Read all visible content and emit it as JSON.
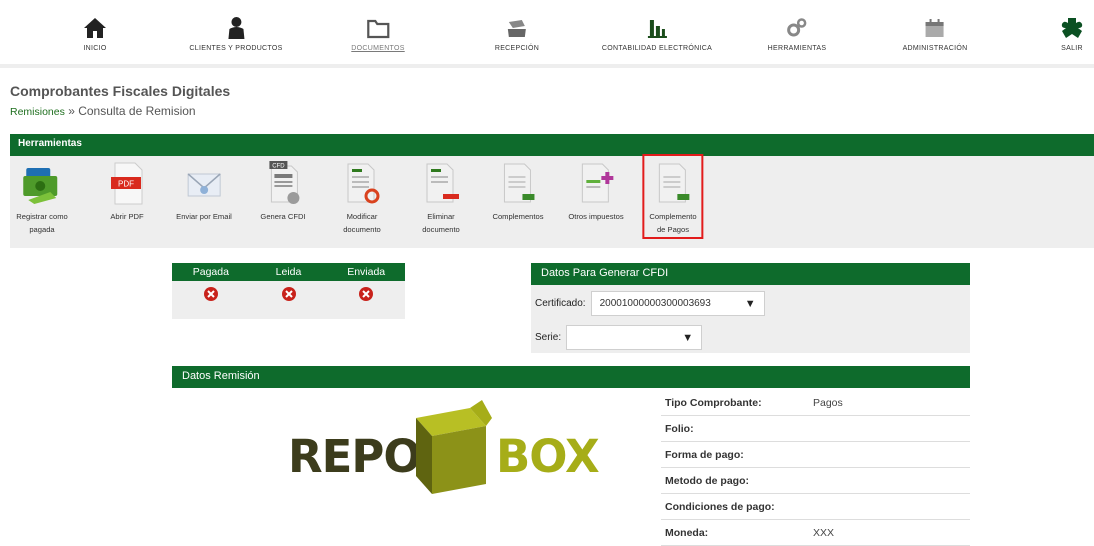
{
  "nav": {
    "items": [
      {
        "label": "INICIO",
        "icon": "home-icon"
      },
      {
        "label": "CLIENTES Y PRODUCTOS",
        "icon": "person-icon"
      },
      {
        "label": "DOCUMENTOS",
        "icon": "folder-icon",
        "active": true
      },
      {
        "label": "RECEPCIÓN",
        "icon": "inbox-icon"
      },
      {
        "label": "CONTABILIDAD ELECTRÓNICA",
        "icon": "bar-chart-icon"
      },
      {
        "label": "HERRAMIENTAS",
        "icon": "gears-icon"
      },
      {
        "label": "ADMINISTRACIÓN",
        "icon": "calendar-icon"
      },
      {
        "label": "SALIR",
        "icon": "puzzle-icon"
      }
    ]
  },
  "page": {
    "title": "Comprobantes Fiscales Digitales",
    "breadcrumb_link": "Remisiones",
    "breadcrumb_sep": " » ",
    "breadcrumb_current": "Consulta de Remision"
  },
  "tools": {
    "header": "Herramientas",
    "items": [
      {
        "label": "Registrar como\npagada",
        "icon": "money-icon"
      },
      {
        "label": "Abrir PDF",
        "icon": "pdf-icon"
      },
      {
        "label": "Enviar por Email",
        "icon": "email-icon"
      },
      {
        "label": "Genera CFDI",
        "icon": "cfd-document-icon"
      },
      {
        "label": "Modificar\ndocumento",
        "icon": "edit-document-icon"
      },
      {
        "label": "Eliminar\ndocumento",
        "icon": "delete-document-icon"
      },
      {
        "label": "Complementos",
        "icon": "xml-document-icon"
      },
      {
        "label": "Otros impuestos",
        "icon": "add-document-icon"
      },
      {
        "label": "Complemento\nde Pagos",
        "icon": "xml-document-icon",
        "highlighted": true
      }
    ]
  },
  "status": {
    "columns": [
      "Pagada",
      "Leida",
      "Enviada"
    ],
    "values": [
      "no",
      "no",
      "no"
    ]
  },
  "cfdi": {
    "header": "Datos Para Generar CFDI",
    "certificado_label": "Certificado:",
    "certificado_value": "20001000000300003693",
    "serie_label": "Serie:",
    "serie_value": ""
  },
  "remision": {
    "header": "Datos Remisión",
    "logo_left": "REPO",
    "logo_right": "BOX",
    "fields": [
      {
        "key": "Tipo Comprobante:",
        "value": "Pagos"
      },
      {
        "key": "Folio:",
        "value": ""
      },
      {
        "key": "Forma de pago:",
        "value": ""
      },
      {
        "key": "Metodo de pago:",
        "value": ""
      },
      {
        "key": "Condiciones de pago:",
        "value": ""
      },
      {
        "key": "Moneda:",
        "value": "XXX"
      }
    ]
  },
  "colors": {
    "primary_green": "#0e6b2c",
    "highlight_red": "#e21b1b",
    "logo_olive": "#a6ad18"
  }
}
